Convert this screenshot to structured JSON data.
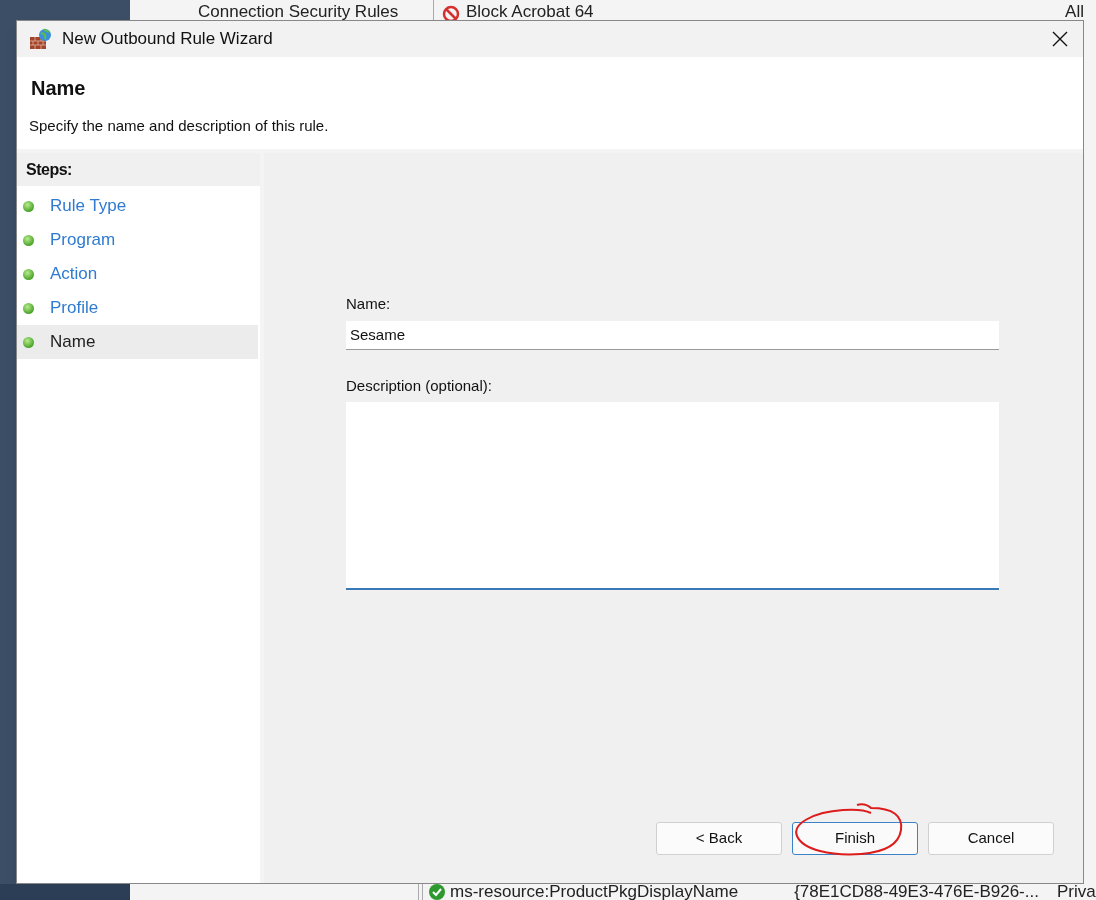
{
  "background": {
    "top_items": [
      "Connection Security Rules",
      "Block Acrobat 64",
      "All"
    ],
    "bottom_items": [
      "ms-resource:ProductPkgDisplayName",
      "{78E1CD88-49E3-476E-B926-...",
      "Priva"
    ]
  },
  "window": {
    "title": "New Outbound Rule Wizard"
  },
  "header": {
    "title": "Name",
    "subtitle": "Specify the name and description of this rule."
  },
  "steps": {
    "title": "Steps:",
    "items": [
      {
        "label": "Rule Type",
        "selected": false
      },
      {
        "label": "Program",
        "selected": false
      },
      {
        "label": "Action",
        "selected": false
      },
      {
        "label": "Profile",
        "selected": false
      },
      {
        "label": "Name",
        "selected": true
      }
    ]
  },
  "form": {
    "name_label": "Name:",
    "name_value": "Sesame",
    "description_label": "Description (optional):"
  },
  "buttons": [
    {
      "label": "< Back",
      "default": false,
      "circled": false
    },
    {
      "label": "Finish",
      "default": true,
      "circled": true
    },
    {
      "label": "Cancel",
      "default": false,
      "circled": false
    }
  ]
}
